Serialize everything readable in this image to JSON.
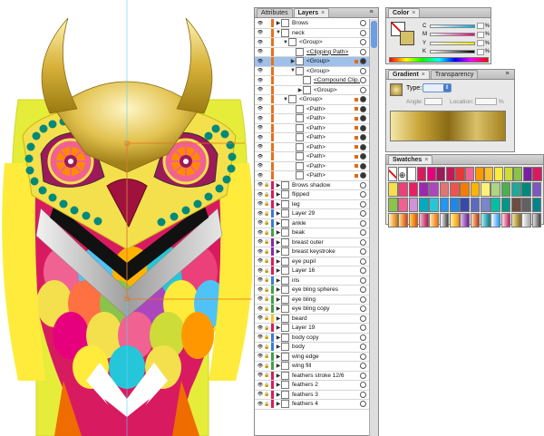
{
  "layers_panel": {
    "tabs": [
      {
        "label": "Attributes",
        "active": false
      },
      {
        "label": "Layers",
        "active": true
      }
    ],
    "close_label": "×",
    "menu_label": "≡",
    "rows": [
      {
        "label": "Brows",
        "indent": 0,
        "expand": "▶",
        "color": "#e8701a",
        "target": false
      },
      {
        "label": "neck",
        "indent": 0,
        "expand": "▼",
        "color": "#e8701a",
        "target": false
      },
      {
        "label": "<Group>",
        "indent": 1,
        "expand": "▼",
        "color": "#e8701a",
        "target": false
      },
      {
        "label": "<Clipping Path>",
        "indent": 2,
        "expand": "",
        "color": "#e8701a",
        "target": false,
        "underline": true
      },
      {
        "label": "<Group>",
        "indent": 2,
        "expand": "▶",
        "color": "#e8701a",
        "target": true,
        "selected": "strong"
      },
      {
        "label": "<Group>",
        "indent": 2,
        "expand": "▼",
        "color": "#e8701a",
        "target": false
      },
      {
        "label": "<Compound Clip...",
        "indent": 3,
        "expand": "",
        "color": "#e8701a",
        "target": false,
        "underline": true
      },
      {
        "label": "<Group>",
        "indent": 3,
        "expand": "▶",
        "color": "#e8701a",
        "target": false
      },
      {
        "label": "<Group>",
        "indent": 1,
        "expand": "▼",
        "color": "#e8701a",
        "target": true
      },
      {
        "label": "<Path>",
        "indent": 2,
        "expand": "",
        "color": "#e8701a",
        "target": true
      },
      {
        "label": "<Path>",
        "indent": 2,
        "expand": "",
        "color": "#e8701a",
        "target": true
      },
      {
        "label": "<Path>",
        "indent": 2,
        "expand": "",
        "color": "#e8701a",
        "target": true
      },
      {
        "label": "<Path>",
        "indent": 2,
        "expand": "",
        "color": "#e8701a",
        "target": true
      },
      {
        "label": "<Path>",
        "indent": 2,
        "expand": "",
        "color": "#e8701a",
        "target": true
      },
      {
        "label": "<Path>",
        "indent": 2,
        "expand": "",
        "color": "#e8701a",
        "target": true
      },
      {
        "label": "<Path>",
        "indent": 2,
        "expand": "",
        "color": "#e8701a",
        "target": true
      },
      {
        "label": "<Path>",
        "indent": 2,
        "expand": "",
        "color": "#e8701a",
        "target": true
      },
      {
        "label": "Brows shadow",
        "indent": 0,
        "expand": "▶",
        "color": "#d81b60",
        "target": false,
        "locked": true
      },
      {
        "label": "flipped",
        "indent": 0,
        "expand": "▶",
        "color": "#d81b60",
        "target": false,
        "locked": true
      },
      {
        "label": "leg",
        "indent": 0,
        "expand": "▶",
        "color": "#d81b60",
        "target": false,
        "locked": true
      },
      {
        "label": "Layer 29",
        "indent": 0,
        "expand": "▶",
        "color": "#3a7bd5",
        "target": false,
        "locked": true
      },
      {
        "label": "ankle",
        "indent": 0,
        "expand": "▶",
        "color": "#3a7bd5",
        "target": false,
        "locked": true
      },
      {
        "label": "beak",
        "indent": 0,
        "expand": "▶",
        "color": "#43a047",
        "target": false,
        "locked": true
      },
      {
        "label": "breast outer",
        "indent": 0,
        "expand": "▶",
        "color": "#8e24aa",
        "target": false,
        "locked": true
      },
      {
        "label": "breast keystroke",
        "indent": 0,
        "expand": "▶",
        "color": "#8e24aa",
        "target": false,
        "locked": true
      },
      {
        "label": "eye pupil",
        "indent": 0,
        "expand": "▶",
        "color": "#d81b60",
        "target": false,
        "locked": true
      },
      {
        "label": "Layer 16",
        "indent": 0,
        "expand": "▶",
        "color": "#d81b60",
        "target": false,
        "locked": true
      },
      {
        "label": "iris",
        "indent": 0,
        "expand": "▶",
        "color": "#3a7bd5",
        "target": false,
        "locked": true
      },
      {
        "label": "eye bling spheres",
        "indent": 0,
        "expand": "▶",
        "color": "#43a047",
        "target": false,
        "locked": true
      },
      {
        "label": "eye bling",
        "indent": 0,
        "expand": "▶",
        "color": "#43a047",
        "target": false,
        "locked": true
      },
      {
        "label": "eye bling copy",
        "indent": 0,
        "expand": "▶",
        "color": "#43a047",
        "target": false,
        "locked": true
      },
      {
        "label": "beard",
        "indent": 0,
        "expand": "▶",
        "color": "#fbc02d",
        "target": false,
        "locked": true
      },
      {
        "label": "Layer 19",
        "indent": 0,
        "expand": "▶",
        "color": "#d81b60",
        "target": false,
        "locked": true
      },
      {
        "label": "body copy",
        "indent": 0,
        "expand": "▶",
        "color": "#3a7bd5",
        "target": false,
        "locked": true
      },
      {
        "label": "body",
        "indent": 0,
        "expand": "▶",
        "color": "#3a7bd5",
        "target": false,
        "locked": true
      },
      {
        "label": "wing edge",
        "indent": 0,
        "expand": "▶",
        "color": "#43a047",
        "target": false,
        "locked": true
      },
      {
        "label": "wing fill",
        "indent": 0,
        "expand": "▶",
        "color": "#43a047",
        "target": false,
        "locked": true
      },
      {
        "label": "feathers stroke 12/6",
        "indent": 0,
        "expand": "▶",
        "color": "#d81b60",
        "target": false,
        "locked": true
      },
      {
        "label": "feathers 2",
        "indent": 0,
        "expand": "▶",
        "color": "#d81b60",
        "target": false,
        "locked": true
      },
      {
        "label": "feathers 3",
        "indent": 0,
        "expand": "▶",
        "color": "#d81b60",
        "target": false,
        "locked": true
      },
      {
        "label": "feathers 4",
        "indent": 0,
        "expand": "▶",
        "color": "#d81b60",
        "target": false,
        "locked": true
      }
    ]
  },
  "color_panel": {
    "tab": "Color",
    "close_label": "×",
    "channels": [
      {
        "name": "C",
        "grad_from": "#ffffff",
        "grad_to": "#00a6e6",
        "pct": "%"
      },
      {
        "name": "M",
        "grad_from": "#ffffff",
        "grad_to": "#e6007e",
        "pct": "%"
      },
      {
        "name": "Y",
        "grad_from": "#ffffff",
        "grad_to": "#ffed00",
        "pct": "%"
      },
      {
        "name": "K",
        "grad_from": "#ffffff",
        "grad_to": "#000000",
        "pct": "%"
      }
    ]
  },
  "gradient_panel": {
    "tabs": [
      {
        "label": "Gradient",
        "active": true
      },
      {
        "label": "Transparency",
        "active": false
      }
    ],
    "close_label": "×",
    "type_label": "Type:",
    "angle_label": "Angle:",
    "location_label": "Location:",
    "pct": "%",
    "gradient_colors": [
      "#f4e7a6",
      "#c9a53a",
      "#8a6a14",
      "#d9c16a",
      "#a5801e"
    ]
  },
  "swatches_panel": {
    "tab": "Swatches",
    "close_label": "×",
    "colors_row1": [
      "#ffffff",
      "#d81b60",
      "#e6007e",
      "#9c1a5a",
      "#c2185b",
      "#e53935",
      "#f06292",
      "#ff9800",
      "#fbc02d",
      "#ffeb3b",
      "#cddc39",
      "#8bc34a",
      "#7b1fa2",
      "#d81b60"
    ],
    "colors_row2": [
      "#f4e04d",
      "#ec407a",
      "#e91e63",
      "#9c27b0",
      "#ab47bc",
      "#e57373",
      "#ef5350",
      "#f57c00",
      "#ffb300",
      "#fff176",
      "#aed581",
      "#4caf50",
      "#26a69a",
      "#00897b",
      "#7e57c2"
    ],
    "colors_row3": [
      "#8bc34a",
      "#f06292",
      "#ce93d8",
      "#00acc1",
      "#26c6da",
      "#2196f3",
      "#1e88e5",
      "#3949ab",
      "#5c6bc0",
      "#7986cb",
      "#00bfa5",
      "#009688",
      "#6d4c41",
      "#616161",
      "#00838f"
    ],
    "gradient_swatches": [
      [
        "#fff3c4",
        "#e07b00"
      ],
      [
        "#ffe082",
        "#d84315"
      ],
      [
        "#ffd54f",
        "#e65100"
      ],
      [
        "#f8bbd0",
        "#ad1457"
      ],
      [
        "#ffecb3",
        "#ef6c00"
      ],
      [
        "#ffffff",
        "#444444"
      ],
      [
        "#fff59d",
        "#ff8f00"
      ],
      [
        "#e1bee7",
        "#6a1b9a"
      ],
      [
        "#ffe0b2",
        "#bf360c"
      ],
      [
        "#b2ebf2",
        "#00838f"
      ],
      [
        "#ffffff",
        "#2196f3"
      ],
      [
        "#fce4ec",
        "#c2185b"
      ],
      [
        "#f4e7a6",
        "#8a6a14"
      ],
      [
        "#ffffff",
        "#9e9e9e"
      ],
      [
        "#e0e0e0",
        "#424242"
      ]
    ]
  }
}
